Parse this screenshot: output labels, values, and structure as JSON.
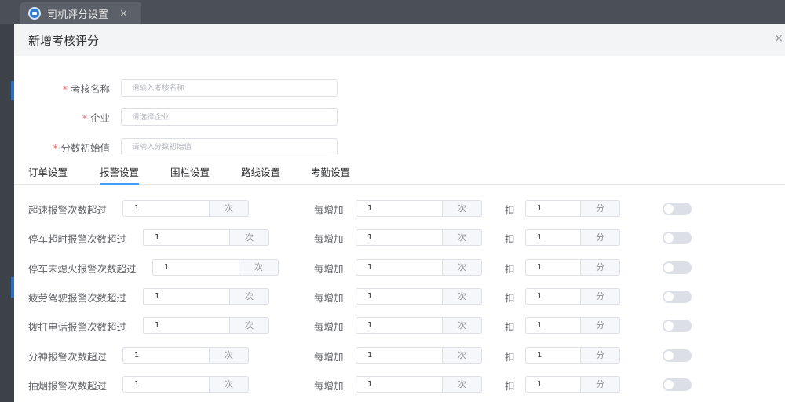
{
  "app_tab": {
    "title": "司机评分设置",
    "close": "×"
  },
  "dialog": {
    "title": "新增考核评分",
    "close": "×",
    "fields": [
      {
        "label": "考核名称",
        "required": "*",
        "placeholder": "请输入考核名称"
      },
      {
        "label": "企业",
        "required": "*",
        "placeholder": "请选择企业"
      },
      {
        "label": "分数初始值",
        "required": "*",
        "placeholder": "请输入分数初始值"
      }
    ],
    "tabs": [
      "订单设置",
      "报警设置",
      "围栏设置",
      "路线设置",
      "考勤设置"
    ],
    "active_tab": "报警设置",
    "rules": [
      {
        "label": "超速报警次数超过",
        "count": "1",
        "count_unit": "次",
        "per_label": "每增加",
        "per": "1",
        "per_unit": "次",
        "deduct_label": "扣",
        "deduct": "1",
        "deduct_unit": "分",
        "enabled": false
      },
      {
        "label": "停车超时报警次数超过",
        "count": "1",
        "count_unit": "次",
        "per_label": "每增加",
        "per": "1",
        "per_unit": "次",
        "deduct_label": "扣",
        "deduct": "1",
        "deduct_unit": "分",
        "enabled": false
      },
      {
        "label": "停车未熄火报警次数超过",
        "count": "1",
        "count_unit": "次",
        "per_label": "每增加",
        "per": "1",
        "per_unit": "次",
        "deduct_label": "扣",
        "deduct": "1",
        "deduct_unit": "分",
        "enabled": false
      },
      {
        "label": "疲劳驾驶报警次数超过",
        "count": "1",
        "count_unit": "次",
        "per_label": "每增加",
        "per": "1",
        "per_unit": "次",
        "deduct_label": "扣",
        "deduct": "1",
        "deduct_unit": "分",
        "enabled": false
      },
      {
        "label": "拨打电话报警次数超过",
        "count": "1",
        "count_unit": "次",
        "per_label": "每增加",
        "per": "1",
        "per_unit": "次",
        "deduct_label": "扣",
        "deduct": "1",
        "deduct_unit": "分",
        "enabled": false
      },
      {
        "label": "分神报警次数超过",
        "count": "1",
        "count_unit": "次",
        "per_label": "每增加",
        "per": "1",
        "per_unit": "次",
        "deduct_label": "扣",
        "deduct": "1",
        "deduct_unit": "分",
        "enabled": false
      },
      {
        "label": "抽烟报警次数超过",
        "count": "1",
        "count_unit": "次",
        "per_label": "每增加",
        "per": "1",
        "per_unit": "次",
        "deduct_label": "扣",
        "deduct": "1",
        "deduct_unit": "分",
        "enabled": false
      }
    ]
  },
  "colors": {
    "accent": "#409eff",
    "required": "#f56c6c"
  }
}
